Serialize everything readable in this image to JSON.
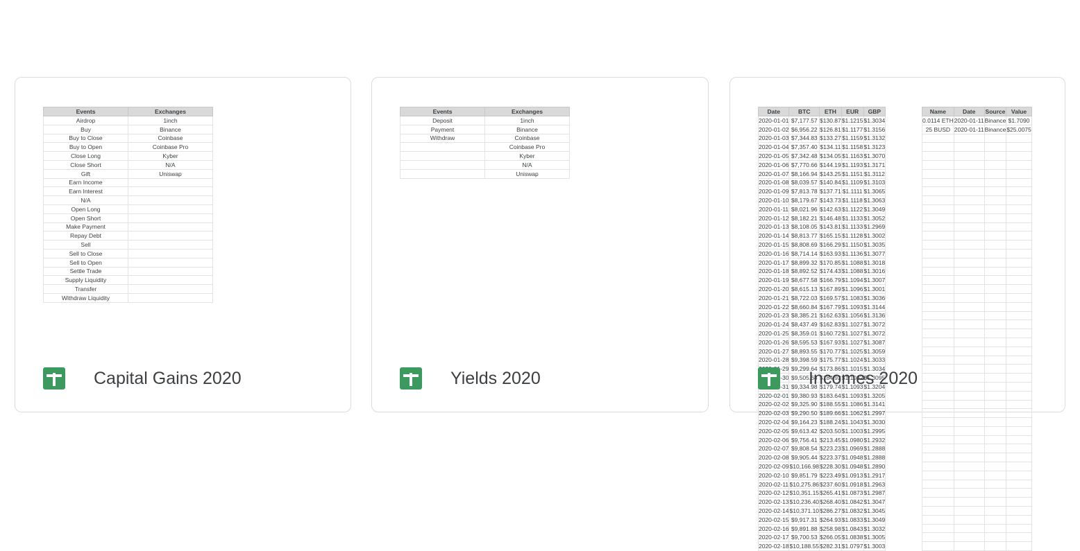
{
  "cards": [
    {
      "title": "Capital Gains 2020",
      "sheet": {
        "headers": [
          "Events",
          "Exchanges"
        ],
        "rows": [
          [
            "Airdrop",
            "1inch"
          ],
          [
            "Buy",
            "Binance"
          ],
          [
            "Buy to Close",
            "Coinbase"
          ],
          [
            "Buy to Open",
            "Coinbase Pro"
          ],
          [
            "Close Long",
            "Kyber"
          ],
          [
            "Close Short",
            "N/A"
          ],
          [
            "Gift",
            "Uniswap"
          ],
          [
            "Earn Income",
            ""
          ],
          [
            "Earn Interest",
            ""
          ],
          [
            "N/A",
            ""
          ],
          [
            "Open Long",
            ""
          ],
          [
            "Open Short",
            ""
          ],
          [
            "Make Payment",
            ""
          ],
          [
            "Repay Debt",
            ""
          ],
          [
            "Sell",
            ""
          ],
          [
            "Sell to Close",
            ""
          ],
          [
            "Sell to Open",
            ""
          ],
          [
            "Settle Trade",
            ""
          ],
          [
            "Supply Liquidity",
            ""
          ],
          [
            "Transfer",
            ""
          ],
          [
            "Withdraw Liquidity",
            ""
          ]
        ]
      }
    },
    {
      "title": "Yields 2020",
      "sheet": {
        "headers": [
          "Events",
          "Exchanges"
        ],
        "rows": [
          [
            "Deposit",
            "1inch"
          ],
          [
            "Payment",
            "Binance"
          ],
          [
            "Withdraw",
            "Coinbase"
          ],
          [
            "",
            "Coinbase Pro"
          ],
          [
            "",
            "Kyber"
          ],
          [
            "",
            "N/A"
          ],
          [
            "",
            "Uniswap"
          ]
        ]
      }
    },
    {
      "title": "Incomes 2020",
      "sheet": {
        "headers": [
          "Date",
          "BTC",
          "ETH",
          "EUR",
          "GBP"
        ],
        "rows": [
          [
            "2020-01-01",
            "$7,177.57",
            "$130.87",
            "$1.1215",
            "$1.3034"
          ],
          [
            "2020-01-02",
            "$6,956.22",
            "$126.81",
            "$1.1177",
            "$1.3156"
          ],
          [
            "2020-01-03",
            "$7,344.83",
            "$133.27",
            "$1.1159",
            "$1.3132"
          ],
          [
            "2020-01-04",
            "$7,357.40",
            "$134.11",
            "$1.1158",
            "$1.3123"
          ],
          [
            "2020-01-05",
            "$7,342.48",
            "$134.05",
            "$1.1163",
            "$1.3070"
          ],
          [
            "2020-01-06",
            "$7,770.66",
            "$144.19",
            "$1.1193",
            "$1.3171"
          ],
          [
            "2020-01-07",
            "$8,166.94",
            "$143.25",
            "$1.1151",
            "$1.3112"
          ],
          [
            "2020-01-08",
            "$8,039.57",
            "$140.84",
            "$1.1109",
            "$1.3103"
          ],
          [
            "2020-01-09",
            "$7,813.78",
            "$137.71",
            "$1.1111",
            "$1.3065"
          ],
          [
            "2020-01-10",
            "$8,179.67",
            "$143.73",
            "$1.1118",
            "$1.3063"
          ],
          [
            "2020-01-11",
            "$8,021.96",
            "$142.63",
            "$1.1122",
            "$1.3049"
          ],
          [
            "2020-01-12",
            "$8,182.21",
            "$146.48",
            "$1.1133",
            "$1.3052"
          ],
          [
            "2020-01-13",
            "$8,108.05",
            "$143.81",
            "$1.1133",
            "$1.2969"
          ],
          [
            "2020-01-14",
            "$8,813.77",
            "$165.15",
            "$1.1128",
            "$1.3002"
          ],
          [
            "2020-01-15",
            "$8,808.69",
            "$166.29",
            "$1.1150",
            "$1.3035"
          ],
          [
            "2020-01-16",
            "$8,714.14",
            "$163.93",
            "$1.1136",
            "$1.3077"
          ],
          [
            "2020-01-17",
            "$8,899.32",
            "$170.85",
            "$1.1088",
            "$1.3018"
          ],
          [
            "2020-01-18",
            "$8,892.52",
            "$174.43",
            "$1.1088",
            "$1.3016"
          ],
          [
            "2020-01-19",
            "$8,677.58",
            "$166.79",
            "$1.1094",
            "$1.3007"
          ],
          [
            "2020-01-20",
            "$8,615.13",
            "$167.89",
            "$1.1096",
            "$1.3001"
          ],
          [
            "2020-01-21",
            "$8,722.03",
            "$169.57",
            "$1.1083",
            "$1.3036"
          ],
          [
            "2020-01-22",
            "$8,660.84",
            "$167.79",
            "$1.1093",
            "$1.3144"
          ],
          [
            "2020-01-23",
            "$8,385.21",
            "$162.63",
            "$1.1056",
            "$1.3136"
          ],
          [
            "2020-01-24",
            "$8,437.49",
            "$162.83",
            "$1.1027",
            "$1.3072"
          ],
          [
            "2020-01-25",
            "$8,359.01",
            "$160.72",
            "$1.1027",
            "$1.3072"
          ],
          [
            "2020-01-26",
            "$8,595.53",
            "$167.93",
            "$1.1027",
            "$1.3087"
          ],
          [
            "2020-01-27",
            "$8,893.55",
            "$170.77",
            "$1.1025",
            "$1.3059"
          ],
          [
            "2020-01-28",
            "$9,398.59",
            "$175.77",
            "$1.1024",
            "$1.3033"
          ],
          [
            "2020-01-29",
            "$9,299.64",
            "$173.86",
            "$1.1015",
            "$1.3034"
          ],
          [
            "2020-01-30",
            "$9,505.68",
            "$184.92",
            "$1.1032",
            "$1.3095"
          ],
          [
            "2020-01-31",
            "$9,334.98",
            "$179.74",
            "$1.1093",
            "$1.3204"
          ],
          [
            "2020-02-01",
            "$9,380.93",
            "$183.64",
            "$1.1093",
            "$1.3205"
          ],
          [
            "2020-02-02",
            "$9,325.90",
            "$188.55",
            "$1.1086",
            "$1.3141"
          ],
          [
            "2020-02-03",
            "$9,290.50",
            "$189.66",
            "$1.1062",
            "$1.2997"
          ],
          [
            "2020-02-04",
            "$9,164.23",
            "$188.24",
            "$1.1043",
            "$1.3030"
          ],
          [
            "2020-02-05",
            "$9,613.42",
            "$203.50",
            "$1.1003",
            "$1.2995"
          ],
          [
            "2020-02-06",
            "$9,756.41",
            "$213.45",
            "$1.0980",
            "$1.2932"
          ],
          [
            "2020-02-07",
            "$9,808.54",
            "$223.23",
            "$1.0969",
            "$1.2888"
          ],
          [
            "2020-02-08",
            "$9,905.44",
            "$223.37",
            "$1.0948",
            "$1.2888"
          ],
          [
            "2020-02-09",
            "$10,166.98",
            "$228.30",
            "$1.0948",
            "$1.2890"
          ],
          [
            "2020-02-10",
            "$9,851.79",
            "$223.49",
            "$1.0913",
            "$1.2917"
          ],
          [
            "2020-02-11",
            "$10,275.86",
            "$237.60",
            "$1.0918",
            "$1.2963"
          ],
          [
            "2020-02-12",
            "$10,351.15",
            "$265.41",
            "$1.0873",
            "$1.2987"
          ],
          [
            "2020-02-13",
            "$10,236.40",
            "$268.40",
            "$1.0842",
            "$1.3047"
          ],
          [
            "2020-02-14",
            "$10,371.10",
            "$286.27",
            "$1.0832",
            "$1.3045"
          ],
          [
            "2020-02-15",
            "$9,917.31",
            "$264.93",
            "$1.0833",
            "$1.3049"
          ],
          [
            "2020-02-16",
            "$9,891.88",
            "$258.98",
            "$1.0843",
            "$1.3032"
          ],
          [
            "2020-02-17",
            "$9,700.53",
            "$266.05",
            "$1.0838",
            "$1.3005"
          ],
          [
            "2020-02-18",
            "$10,188.55",
            "$282.31",
            "$1.0797",
            "$1.3003"
          ]
        ]
      },
      "sheet2": {
        "headers": [
          "Name",
          "Date",
          "Source",
          "Value"
        ],
        "rows": [
          [
            "0.0114 ETH",
            "2020-01-11",
            "Binance",
            "$1.7090"
          ],
          [
            "25 BUSD",
            "2020-01-11",
            "Binance",
            "$25.0075"
          ]
        ]
      }
    }
  ]
}
